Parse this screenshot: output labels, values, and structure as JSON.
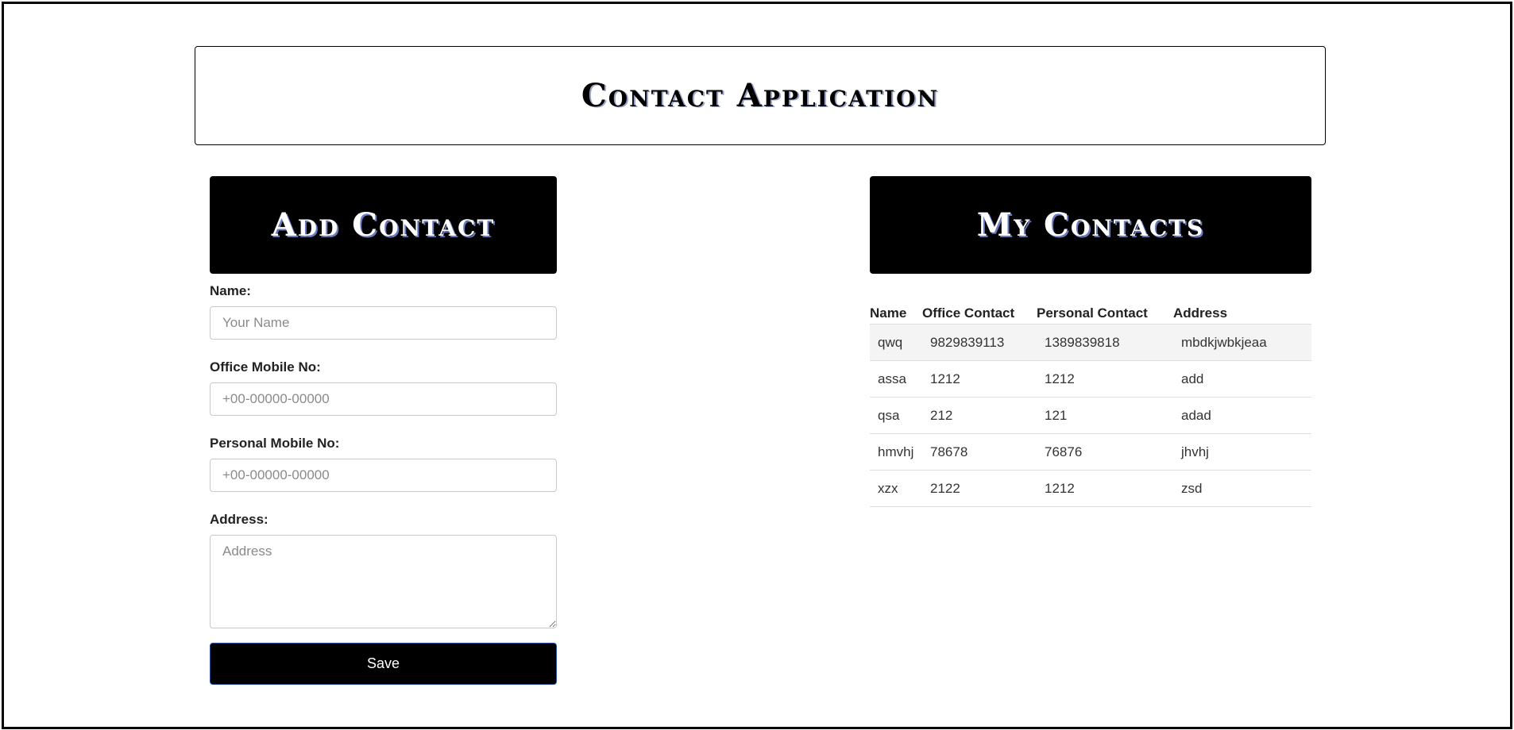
{
  "header": {
    "title": "Contact Application"
  },
  "add_panel": {
    "title": "Add Contact",
    "fields": {
      "name": {
        "label": "Name:",
        "placeholder": "Your Name",
        "value": ""
      },
      "office": {
        "label": "Office Mobile No:",
        "placeholder": "+00-00000-00000",
        "value": ""
      },
      "personal": {
        "label": "Personal Mobile No:",
        "placeholder": "+00-00000-00000",
        "value": ""
      },
      "address": {
        "label": "Address:",
        "placeholder": "Address",
        "value": ""
      }
    },
    "save_label": "Save"
  },
  "contacts_panel": {
    "title": "My Contacts",
    "columns": [
      "Name",
      "Office Contact",
      "Personal Contact",
      "Address"
    ],
    "rows": [
      {
        "name": "qwq",
        "office": "9829839113",
        "personal": "1389839818",
        "address": "mbdkjwbkjeaa"
      },
      {
        "name": "assa",
        "office": "1212",
        "personal": "1212",
        "address": "add"
      },
      {
        "name": "qsa",
        "office": "212",
        "personal": "121",
        "address": "adad"
      },
      {
        "name": "hmvhj",
        "office": "78678",
        "personal": "76876",
        "address": "jhvhj"
      },
      {
        "name": "xzx",
        "office": "2122",
        "personal": "1212",
        "address": "zsd"
      }
    ]
  },
  "colors": {
    "banner_bg": "#000000",
    "banner_text": "#ffffff",
    "border": "#000000"
  }
}
